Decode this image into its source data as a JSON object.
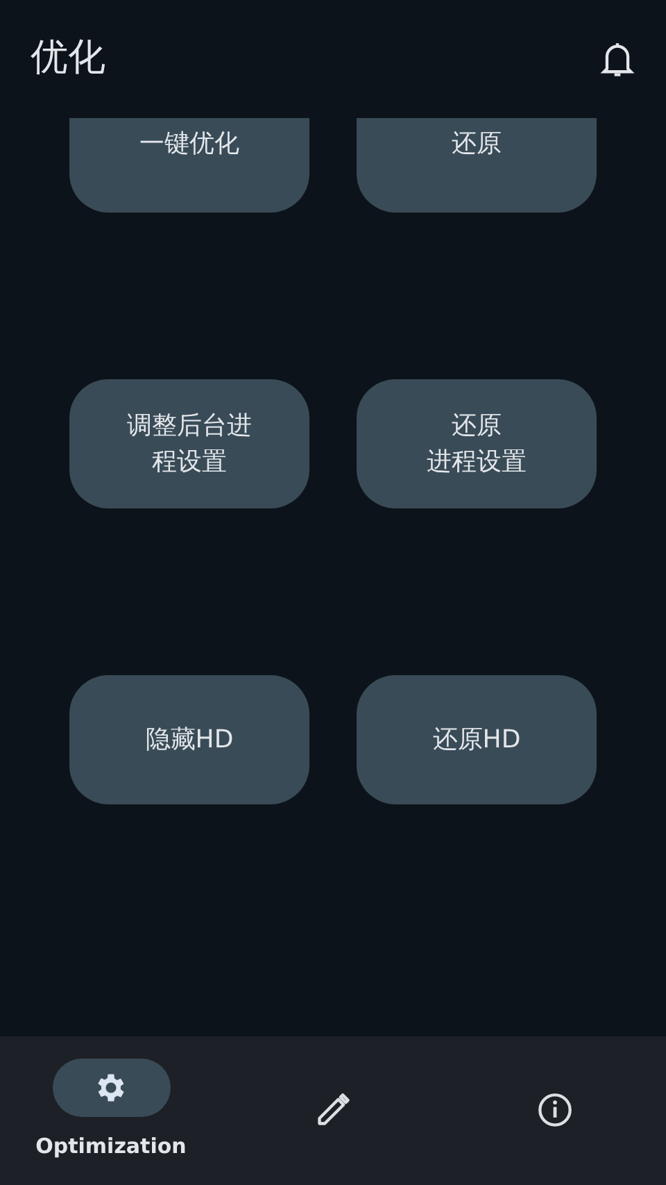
{
  "app_bar": {
    "title": "优化"
  },
  "buttons": [
    {
      "lines": [
        "一键优化"
      ],
      "clipped": true
    },
    {
      "lines": [
        "还原"
      ],
      "clipped": true
    },
    {
      "lines": [
        "调整后台进程设置"
      ],
      "clipped": false
    },
    {
      "lines": [
        "还原",
        "进程设置"
      ],
      "clipped": false
    },
    {
      "lines": [
        "隐藏HD"
      ],
      "clipped": false
    },
    {
      "lines": [
        "还原HD"
      ],
      "clipped": false
    }
  ],
  "bottom_nav": [
    {
      "label": "Optimization",
      "selected": true
    },
    {
      "selected": false
    },
    {
      "selected": false
    }
  ]
}
